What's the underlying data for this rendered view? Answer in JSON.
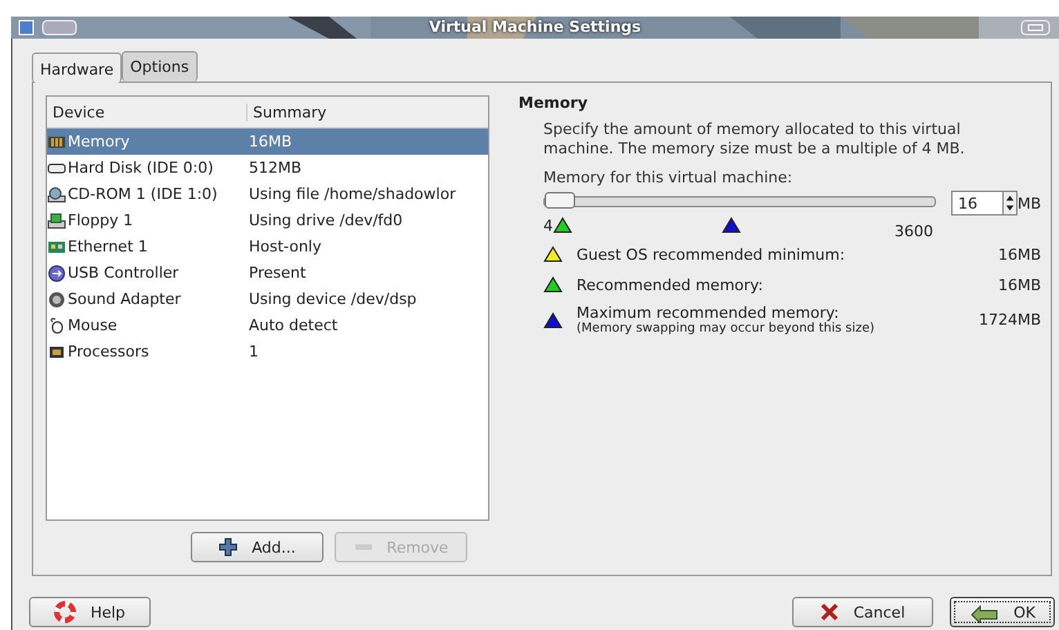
{
  "window": {
    "title": "Virtual Machine Settings"
  },
  "tabs": [
    {
      "label": "Hardware",
      "selected": true
    },
    {
      "label": "Options",
      "selected": false
    }
  ],
  "device_table": {
    "columns": [
      "Device",
      "Summary"
    ],
    "rows": [
      {
        "kind": "memory",
        "device": "Memory",
        "summary": "16MB",
        "selected": true
      },
      {
        "kind": "disk",
        "device": "Hard Disk (IDE 0:0)",
        "summary": "512MB",
        "selected": false
      },
      {
        "kind": "cdrom",
        "device": "CD-ROM 1 (IDE 1:0)",
        "summary": "Using file /home/shadowlor",
        "selected": false
      },
      {
        "kind": "floppy",
        "device": "Floppy 1",
        "summary": "Using drive /dev/fd0",
        "selected": false
      },
      {
        "kind": "ethernet",
        "device": "Ethernet 1",
        "summary": "Host-only",
        "selected": false
      },
      {
        "kind": "usb",
        "device": "USB Controller",
        "summary": "Present",
        "selected": false
      },
      {
        "kind": "sound",
        "device": "Sound Adapter",
        "summary": "Using device /dev/dsp",
        "selected": false
      },
      {
        "kind": "mouse",
        "device": "Mouse",
        "summary": "Auto detect",
        "selected": false
      },
      {
        "kind": "cpu",
        "device": "Processors",
        "summary": "1",
        "selected": false
      }
    ]
  },
  "list_buttons": [
    {
      "kind": "add",
      "label": "Add...",
      "disabled": false
    },
    {
      "kind": "remove",
      "label": "Remove",
      "disabled": true
    }
  ],
  "memory": {
    "heading": "Memory",
    "description": "Specify the amount of memory allocated to this virtual machine. The memory size must be a multiple of 4 MB.",
    "slider_label": "Memory for this virtual machine:",
    "slider": {
      "level": 0.003,
      "min_label": "4",
      "max_label": "3600"
    },
    "markers": [
      {
        "kind": "recommended",
        "color": "#22cc22"
      },
      {
        "kind": "maximum",
        "color": "#1010cc"
      }
    ],
    "value": "16",
    "unit": "MB",
    "legend": [
      {
        "color": "#eeee22",
        "label": "Guest OS recommended minimum:",
        "value": "16MB"
      },
      {
        "color": "#22cc22",
        "label": "Recommended memory:",
        "value": "16MB"
      },
      {
        "color": "#1010cc",
        "label": "Maximum recommended memory:",
        "note": "(Memory swapping may occur beyond this size)",
        "value": "1724MB"
      }
    ]
  },
  "footer_buttons": [
    {
      "kind": "help",
      "label": "Help",
      "default": false
    },
    {
      "kind": "cancel",
      "label": "Cancel",
      "default": false
    },
    {
      "kind": "ok",
      "label": "OK",
      "default": true
    }
  ]
}
